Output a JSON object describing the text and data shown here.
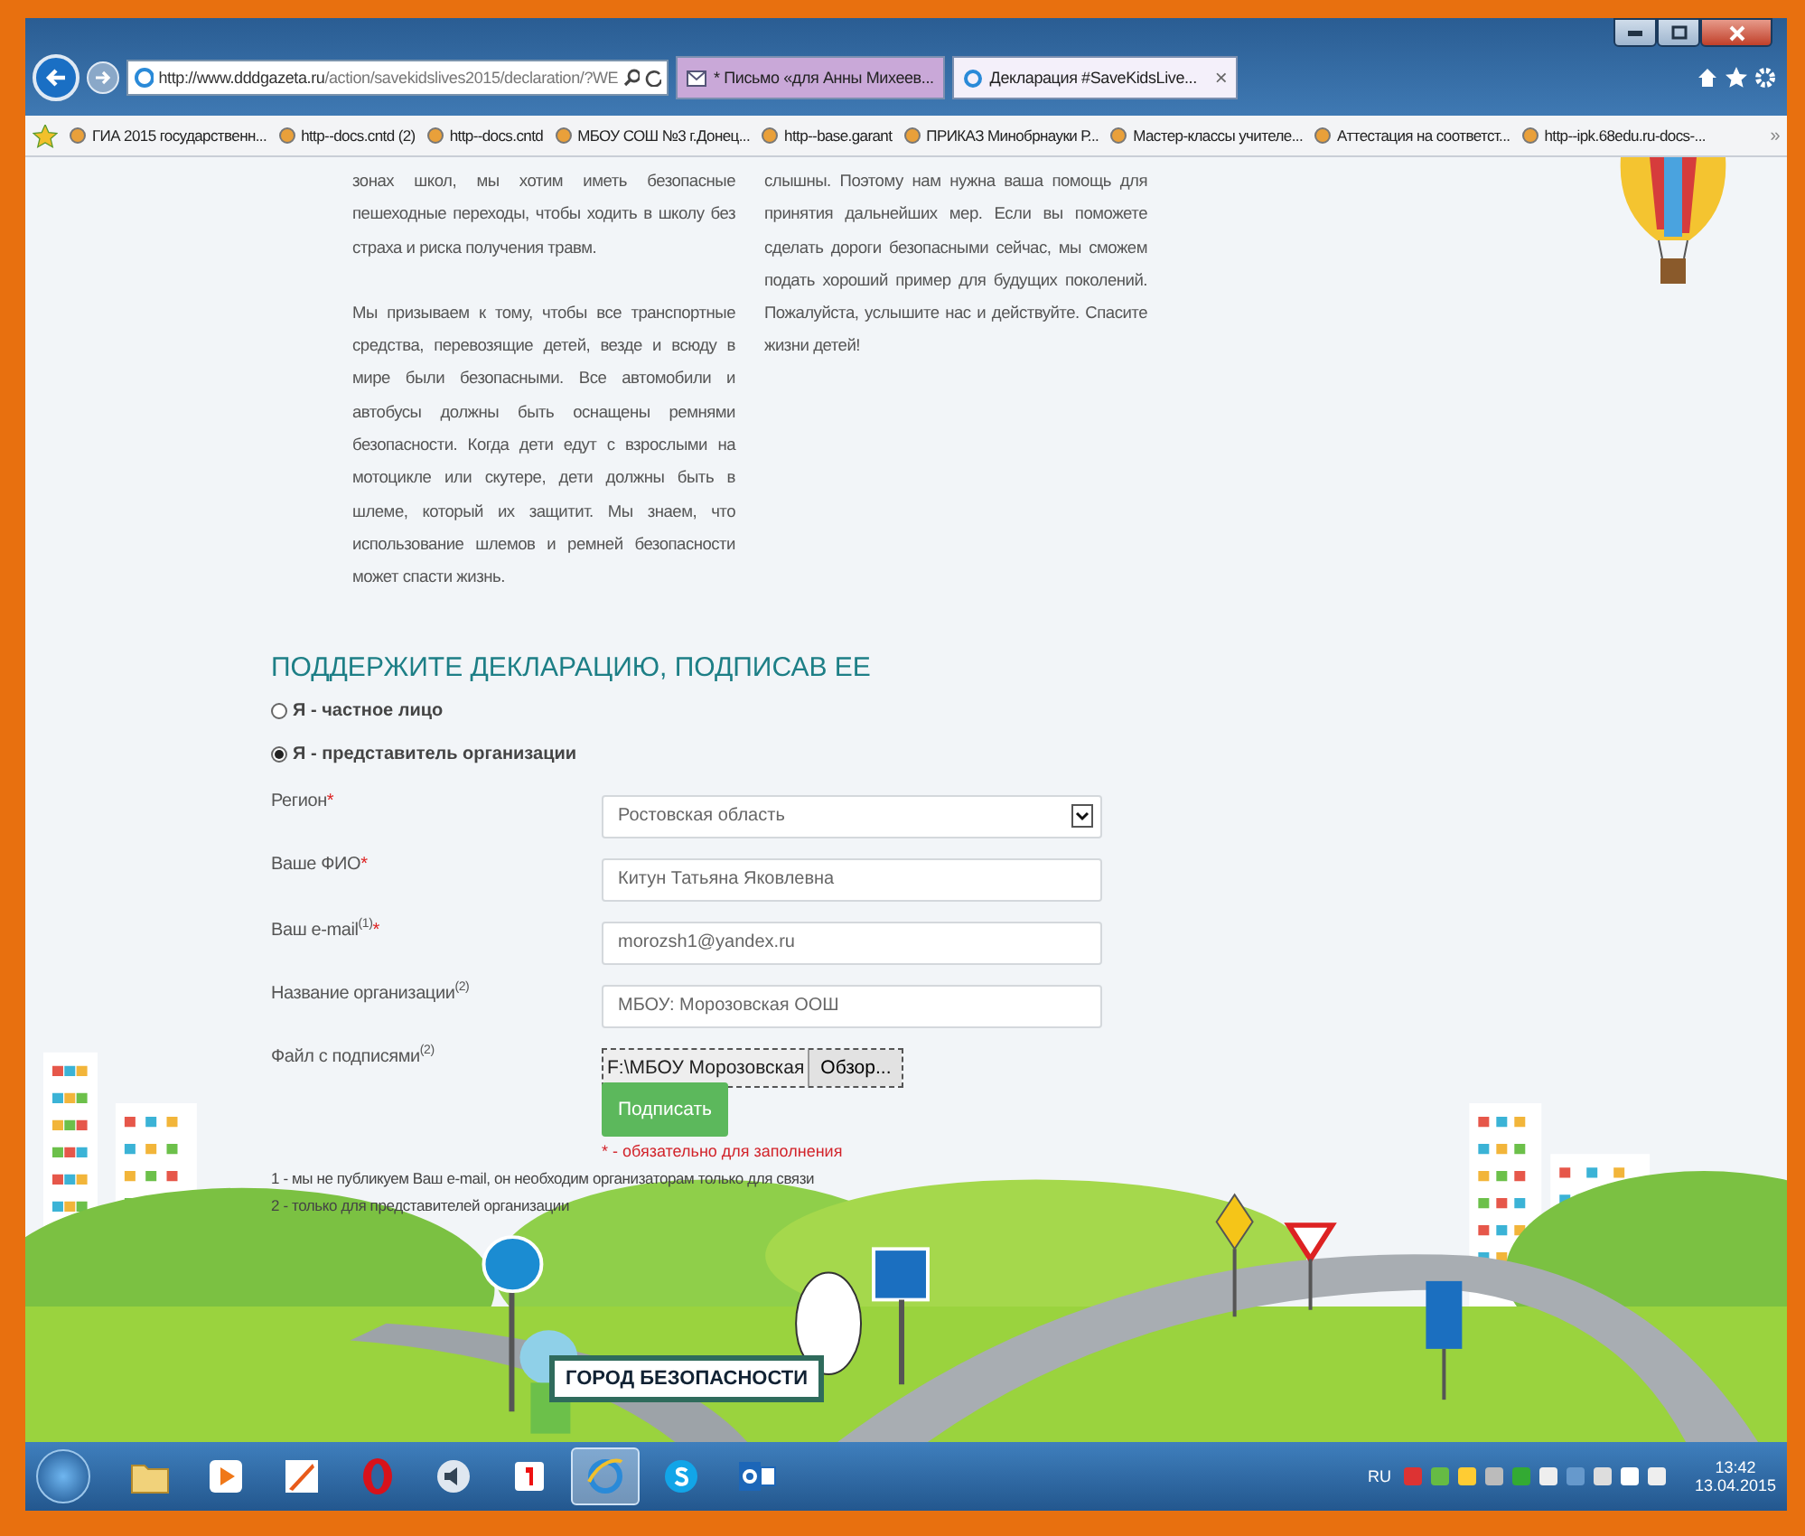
{
  "browser": {
    "address": {
      "host": "http://www.dddgazeta.ru",
      "path": "/action/savekidslives2015/declaration/?WE"
    },
    "tabs": [
      {
        "label": "* Письмо «для Анны Михеев...",
        "kind": "mail",
        "selected": false
      },
      {
        "label": "Декларация #SaveKidsLive...",
        "kind": "page",
        "selected": true,
        "close": "×"
      }
    ],
    "favorites": [
      {
        "label": "ГИА 2015 государственн..."
      },
      {
        "label": "http--docs.cntd (2)"
      },
      {
        "label": "http--docs.cntd"
      },
      {
        "label": "МБОУ СОШ №3 г.Донец..."
      },
      {
        "label": "http--base.garant"
      },
      {
        "label": "ПРИКАЗ Минобрнауки Р..."
      },
      {
        "label": "Мастер-классы учителе..."
      },
      {
        "label": "Аттестация на соответст..."
      },
      {
        "label": "http--ipk.68edu.ru-docs-..."
      }
    ],
    "more": "»"
  },
  "article": {
    "columns": [
      [
        "зонах школ, мы хотим иметь безопасные пешеходные переходы, чтобы ходить в школу без страха и риска получения травм.",
        "Мы призываем к тому, чтобы все транспортные средства, перевозящие детей, везде и всюду в мире были безопасными. Все автомобили и автобусы должны быть оснащены ремнями безопасности. Когда дети едут с взрослыми на мотоцикле или скутере, дети должны быть в шлеме, который их защитит. Мы знаем, что использование шлемов и ремней безопасности может спасти жизнь."
      ],
      [
        "слышны. Поэтому нам нужна ваша помощь для принятия дальнейших мер. Если вы поможете сделать дороги безопасными сейчас, мы сможем подать хороший пример для будущих поколений. Пожалуйста, услышите нас и действуйте. Спасите жизни детей!"
      ]
    ]
  },
  "form": {
    "title": "ПОДДЕРЖИТЕ ДЕКЛАРАЦИЮ, ПОДПИСАВ ЕЕ",
    "options": [
      {
        "label": "Я - частное лицо",
        "selected": false
      },
      {
        "label": "Я - представитель организации",
        "selected": true
      }
    ],
    "fields": [
      {
        "kind": "select",
        "label": "Регион",
        "mark": "*",
        "value": "Ростовская область"
      },
      {
        "kind": "text",
        "label": "Ваше ФИО",
        "mark": "*",
        "value": "Китун Татьяна Яковлевна"
      },
      {
        "kind": "text",
        "label": "Ваш e-mail",
        "note": "(1)",
        "mark": "*",
        "value": "morozsh1@yandex.ru"
      },
      {
        "kind": "text",
        "label": "Название организации",
        "note": "(2)",
        "value": "МБОУ: Морозовская ООШ"
      },
      {
        "kind": "file",
        "label": "Файл с подписями",
        "note": "(2)",
        "value": "F:\\МБОУ Морозовская",
        "browse": "Обзор..."
      }
    ],
    "submit": "Подписать",
    "required_note": "* - обязательно для заполнения",
    "footnotes": [
      "1 - мы не публикуем Ваш e-mail, он необходим организаторам только для связи",
      "2 - только для представителей организации"
    ]
  },
  "banner": {
    "sign": "ГОРОД БЕЗОПАСНОСТИ"
  },
  "taskbar": {
    "items": [
      {
        "kind": "folder",
        "selected": false
      },
      {
        "kind": "media",
        "selected": false
      },
      {
        "kind": "paint",
        "selected": false
      },
      {
        "kind": "opera",
        "selected": false
      },
      {
        "kind": "speaker",
        "selected": false
      },
      {
        "kind": "yandex",
        "selected": false
      },
      {
        "kind": "ie",
        "selected": true
      },
      {
        "kind": "skype",
        "selected": false
      },
      {
        "kind": "outlook",
        "selected": false
      }
    ],
    "language": "RU",
    "time": "13:42",
    "date": "13.04.2015"
  }
}
